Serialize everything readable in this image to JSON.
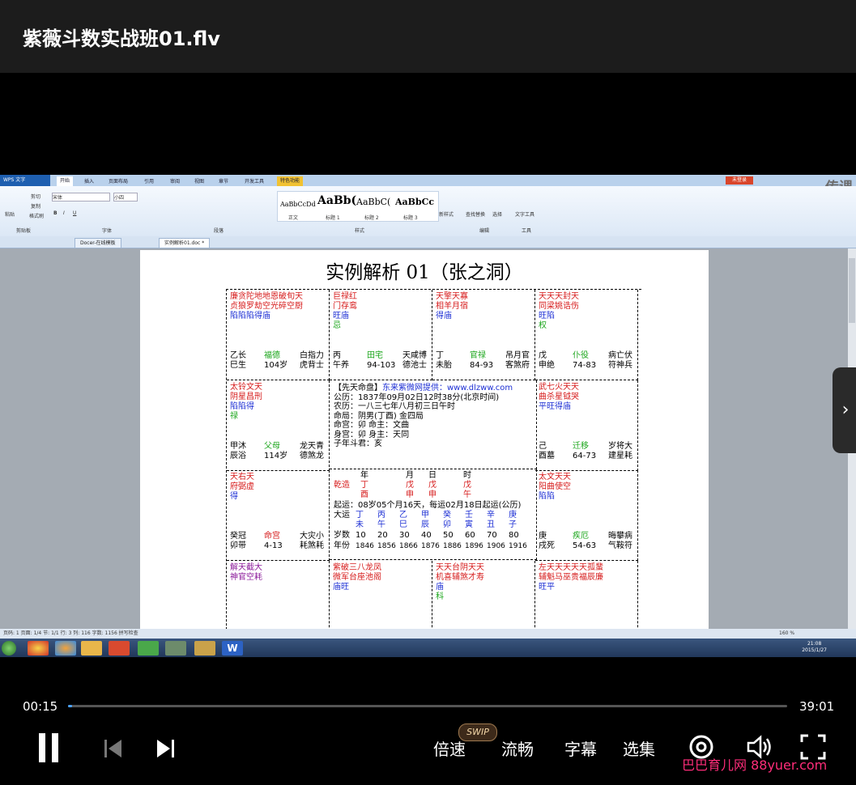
{
  "player": {
    "title": "紫薇斗数实战班01.flv",
    "current_time": "00:15",
    "total_time": "39:01",
    "progress": 0.006,
    "speed_label": "倍速",
    "swip_badge": "SWIP",
    "quality_label": "流畅",
    "subtitle_label": "字幕",
    "episodes_label": "选集",
    "site_watermark": "巴巴育儿网 88yuer.com"
  },
  "wps": {
    "app_name": "WPS 文字",
    "tabs": [
      "开始",
      "插入",
      "页面布局",
      "引用",
      "审阅",
      "视图",
      "章节",
      "开发工具",
      "特色功能"
    ],
    "login": "未登录",
    "watermark": "传课",
    "styles": [
      {
        "sample": "AaBbCcDd",
        "name": "正文"
      },
      {
        "sample": "AaBb(",
        "name": "标题 1"
      },
      {
        "sample": "AaBbC(",
        "name": "标题 2"
      },
      {
        "sample": "AaBbCc",
        "name": "标题 3"
      }
    ],
    "ribbon_labels": {
      "paste": "粘贴",
      "cut": "剪切",
      "copy": "复制",
      "format": "格式刷",
      "font": "宋体",
      "size": "小四",
      "new_style": "新样式",
      "find": "查找替换",
      "select": "选择",
      "text_tool": "文字工具",
      "clipboard": "剪贴板",
      "font_group": "字体",
      "para": "段落",
      "style_group": "样式",
      "edit": "编辑",
      "tools": "工具"
    },
    "doc_tabs": [
      "Docer-在线模板",
      "实例解析01.doc *"
    ],
    "status": "页码: 1  页面: 1/4  节: 1/1  行: 3  列: 116  字数: 1156  拼写检查",
    "zoom": "160 %",
    "clock_time": "21:08",
    "clock_date": "2015/1/27"
  },
  "document": {
    "title": "实例解析 01（张之洞）",
    "cells": [
      {
        "lines": [
          [
            "red",
            "廉贪陀地地恩破旬天"
          ],
          [
            "red",
            "贞狼罗劫空光碎空厨"
          ],
          [
            "blue",
            "陷陷陷得庙"
          ]
        ],
        "bottom": [
          [
            "乙长",
            "blk"
          ],
          [
            "福德",
            "green"
          ],
          [
            "白指力",
            "blk"
          ],
          [
            "巳生",
            "blk"
          ],
          [
            "104岁",
            "blk"
          ],
          [
            "虎背士",
            "blk"
          ]
        ]
      },
      {
        "lines": [
          [
            "red",
            "巨禄红"
          ],
          [
            "red",
            "门存鸾"
          ],
          [
            "blue",
            "旺庙"
          ],
          [
            "green",
            "忌"
          ]
        ],
        "bottom": [
          [
            "丙",
            "blk"
          ],
          [
            "田宅",
            "green"
          ],
          [
            "天咸博",
            "blk"
          ],
          [
            "午养",
            "blk"
          ],
          [
            "94-103",
            "blk"
          ],
          [
            "德池士",
            "blk"
          ]
        ]
      },
      {
        "lines": [
          [
            "red",
            "天擎天寡"
          ],
          [
            "red",
            "相羊月宿"
          ],
          [
            "blue",
            "得庙"
          ]
        ],
        "bottom": [
          [
            "丁",
            "blk"
          ],
          [
            "官禄",
            "green"
          ],
          [
            "吊月官",
            "blk"
          ],
          [
            "未胎",
            "blk"
          ],
          [
            "84-93",
            "blk"
          ],
          [
            "客煞府",
            "blk"
          ]
        ]
      },
      {
        "lines": [
          [
            "red",
            "天天天封天"
          ],
          [
            "red",
            "同梁姚诰伤"
          ],
          [
            "blue",
            "旺陷"
          ],
          [
            "green",
            "权"
          ]
        ],
        "bottom": [
          [
            "戊",
            "blk"
          ],
          [
            "仆役",
            "green"
          ],
          [
            "病亡伏",
            "blk"
          ],
          [
            "申绝",
            "blk"
          ],
          [
            "74-83",
            "blk"
          ],
          [
            "符神兵",
            "blk"
          ]
        ]
      },
      {
        "lines": [
          [
            "red",
            "太铃文天"
          ],
          [
            "red",
            "阴星昌刑"
          ],
          [
            "blue",
            "陷陷得"
          ],
          [
            "green",
            "禄"
          ]
        ],
        "bottom": [
          [
            "甲沐",
            "blk"
          ],
          [
            "父母",
            "green"
          ],
          [
            "龙天青",
            "blk"
          ],
          [
            "辰浴",
            "blk"
          ],
          [
            "114岁",
            "blk"
          ],
          [
            "德煞龙",
            "blk"
          ]
        ]
      },
      {
        "lines": [
          [
            "red",
            "武七火天天"
          ],
          [
            "red",
            "曲杀星钺哭"
          ],
          [
            "blue",
            "平旺得庙"
          ]
        ],
        "bottom": [
          [
            "己",
            "blk"
          ],
          [
            "迁移",
            "green"
          ],
          [
            "岁将大",
            "blk"
          ],
          [
            "酉墓",
            "blk"
          ],
          [
            "64-73",
            "blk"
          ],
          [
            "建星耗",
            "blk"
          ]
        ]
      },
      {
        "lines": [
          [
            "red",
            "天右天"
          ],
          [
            "red",
            "府弼虚"
          ],
          [
            "blue",
            "得"
          ]
        ],
        "bottom": [
          [
            "癸冠",
            "blk"
          ],
          [
            "命宫",
            "red"
          ],
          [
            "大灾小",
            "blk"
          ],
          [
            "卯带",
            "blk"
          ],
          [
            "4-13",
            "blk"
          ],
          [
            "耗煞耗",
            "blk"
          ]
        ]
      },
      {
        "lines": [
          [
            "red",
            "太文天天"
          ],
          [
            "red",
            "阳曲使空"
          ],
          [
            "blue",
            "陷陷"
          ]
        ],
        "bottom": [
          [
            "庚",
            "blk"
          ],
          [
            "疾厄",
            "green"
          ],
          [
            "晦攀病",
            "blk"
          ],
          [
            "戌死",
            "blk"
          ],
          [
            "54-63",
            "blk"
          ],
          [
            "气鞍符",
            "blk"
          ]
        ]
      },
      {
        "lines": [
          [
            "purple",
            "解天截大"
          ],
          [
            "purple",
            "神官空耗"
          ]
        ],
        "bottom": []
      },
      {
        "lines": [
          [
            "red",
            "紫破三八龙凤"
          ],
          [
            "red",
            "微军台座池阁"
          ],
          [
            "blue",
            "庙旺"
          ]
        ],
        "bottom": []
      },
      {
        "lines": [
          [
            "red",
            "天天台阴天天"
          ],
          [
            "red",
            "机喜辅煞才寿"
          ],
          [
            "blue",
            "庙"
          ],
          [
            "green",
            "科"
          ]
        ],
        "bottom": []
      },
      {
        "lines": [
          [
            "red",
            "左天天天天天孤蜚"
          ],
          [
            "red",
            "辅魁马巫贵福辰廉"
          ],
          [
            "blue",
            "  旺平"
          ]
        ],
        "bottom": []
      }
    ],
    "center": {
      "heading": "【先天命盘】",
      "provider": "东来紫微网提供：www.dlzww.com",
      "lines": [
        "公历：1837年09月02日12时38分(北京时间)",
        "农历：一八三七年八月初三日午时",
        "命局：阴男(丁酉)  金四局",
        "命宫：卯     命主：文曲",
        "身宫：卯     身主：天同",
        "子年斗君：亥"
      ]
    },
    "bazi": {
      "header": [
        "年",
        "月",
        "日",
        "时"
      ],
      "label": "乾造",
      "stems": [
        "丁",
        "戊",
        "戊",
        "戊"
      ],
      "branches": [
        "酉",
        "申",
        "申",
        "午"
      ],
      "qiyun": "起运：08岁05个月16天，每运02月18日起运(公历)",
      "dayun_label": "大运",
      "dayun_stems": [
        "丁",
        "丙",
        "乙",
        "甲",
        "癸",
        "壬",
        "辛",
        "庚"
      ],
      "dayun_branches": [
        "未",
        "午",
        "巳",
        "辰",
        "卯",
        "寅",
        "丑",
        "子"
      ],
      "age_label": "岁数",
      "ages": [
        "10",
        "20",
        "30",
        "40",
        "50",
        "60",
        "70",
        "80"
      ],
      "year_label": "年份",
      "years": [
        "1846",
        "1856",
        "1866",
        "1876",
        "1886",
        "1896",
        "1906",
        "1916"
      ]
    }
  }
}
